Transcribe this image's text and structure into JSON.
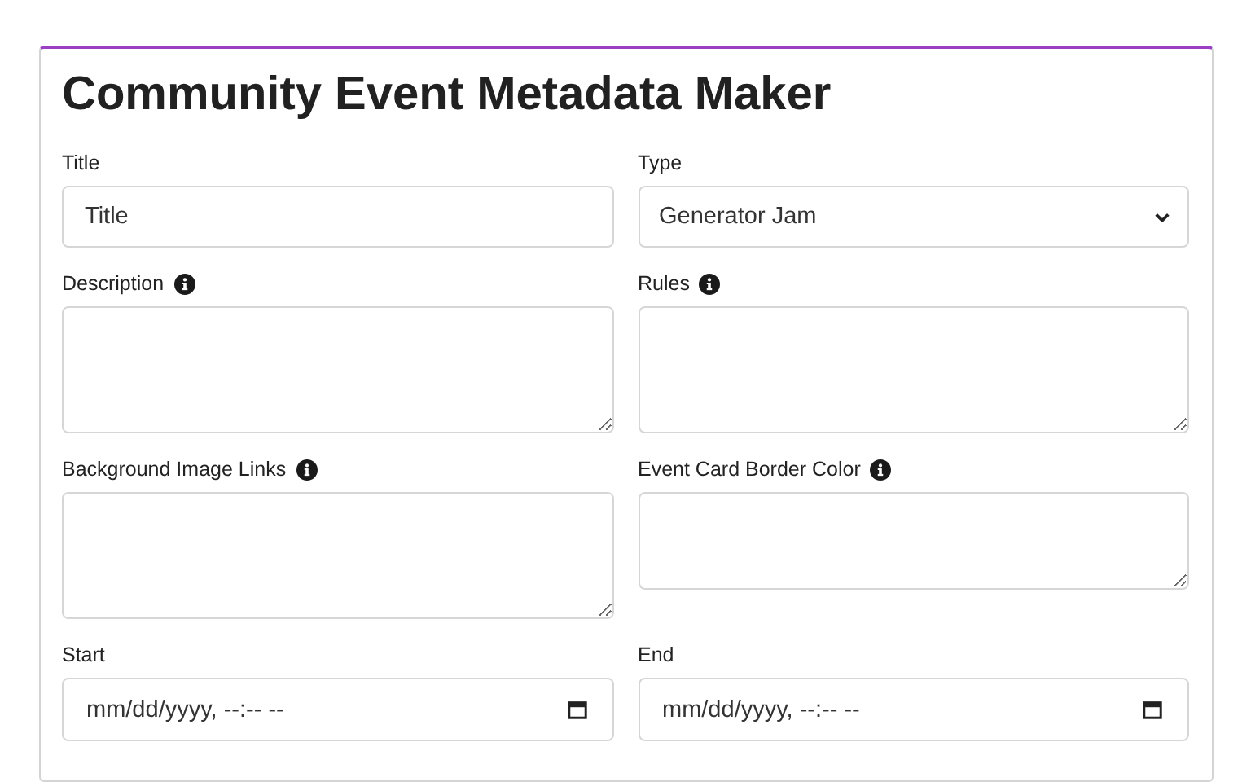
{
  "card": {
    "title": "Community Event Metadata Maker"
  },
  "fields": [
    {
      "label": "Title",
      "kind": "text",
      "info": false,
      "value": "Title"
    },
    {
      "label": "Type",
      "kind": "select",
      "info": false,
      "value": "Generator Jam"
    },
    {
      "label": "Description",
      "kind": "textarea",
      "info": true
    },
    {
      "label": "Rules",
      "kind": "textarea",
      "info": true
    },
    {
      "label": "Background Image Links",
      "kind": "textarea",
      "info": true
    },
    {
      "label": "Event Card Border Color",
      "kind": "smallarea",
      "info": true
    },
    {
      "label": "Start",
      "kind": "datetime",
      "info": false,
      "value": "mm/dd/yyyy, --:-- --"
    },
    {
      "label": "End",
      "kind": "datetime",
      "info": false,
      "value": "mm/dd/yyyy, --:-- --"
    }
  ]
}
